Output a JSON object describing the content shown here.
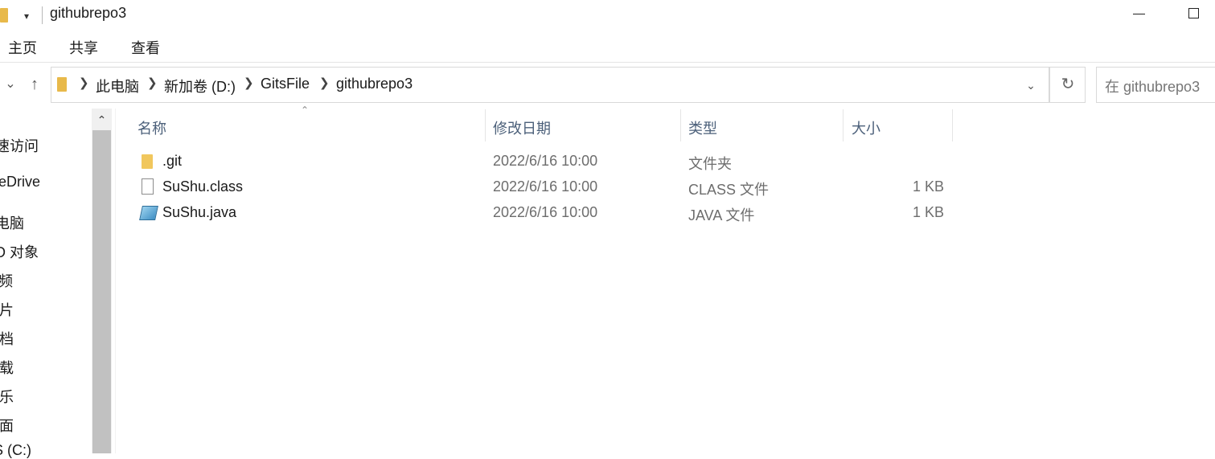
{
  "window": {
    "title": "githubrepo3"
  },
  "ribbon": {
    "tabs": [
      "主页",
      "共享",
      "查看"
    ]
  },
  "address": {
    "crumbs": [
      "此电脑",
      "新加卷 (D:)",
      "GitsFile",
      "githubrepo3"
    ],
    "search_placeholder": "在 githubrepo3"
  },
  "sidebar": {
    "items": [
      "速访问",
      "eDrive",
      "电脑",
      "D 对象",
      "频",
      "片",
      "档",
      "载",
      "乐",
      "面",
      "S (C:)"
    ]
  },
  "columns": {
    "name": "名称",
    "date": "修改日期",
    "type": "类型",
    "size": "大小"
  },
  "files": [
    {
      "icon": "folder-icon",
      "name": ".git",
      "date": "2022/6/16 10:00",
      "type": "文件夹",
      "size": ""
    },
    {
      "icon": "file-icon",
      "name": "SuShu.class",
      "date": "2022/6/16 10:00",
      "type": "CLASS 文件",
      "size": "1 KB"
    },
    {
      "icon": "java-file-icon",
      "name": "SuShu.java",
      "date": "2022/6/16 10:00",
      "type": "JAVA 文件",
      "size": "1 KB"
    }
  ]
}
